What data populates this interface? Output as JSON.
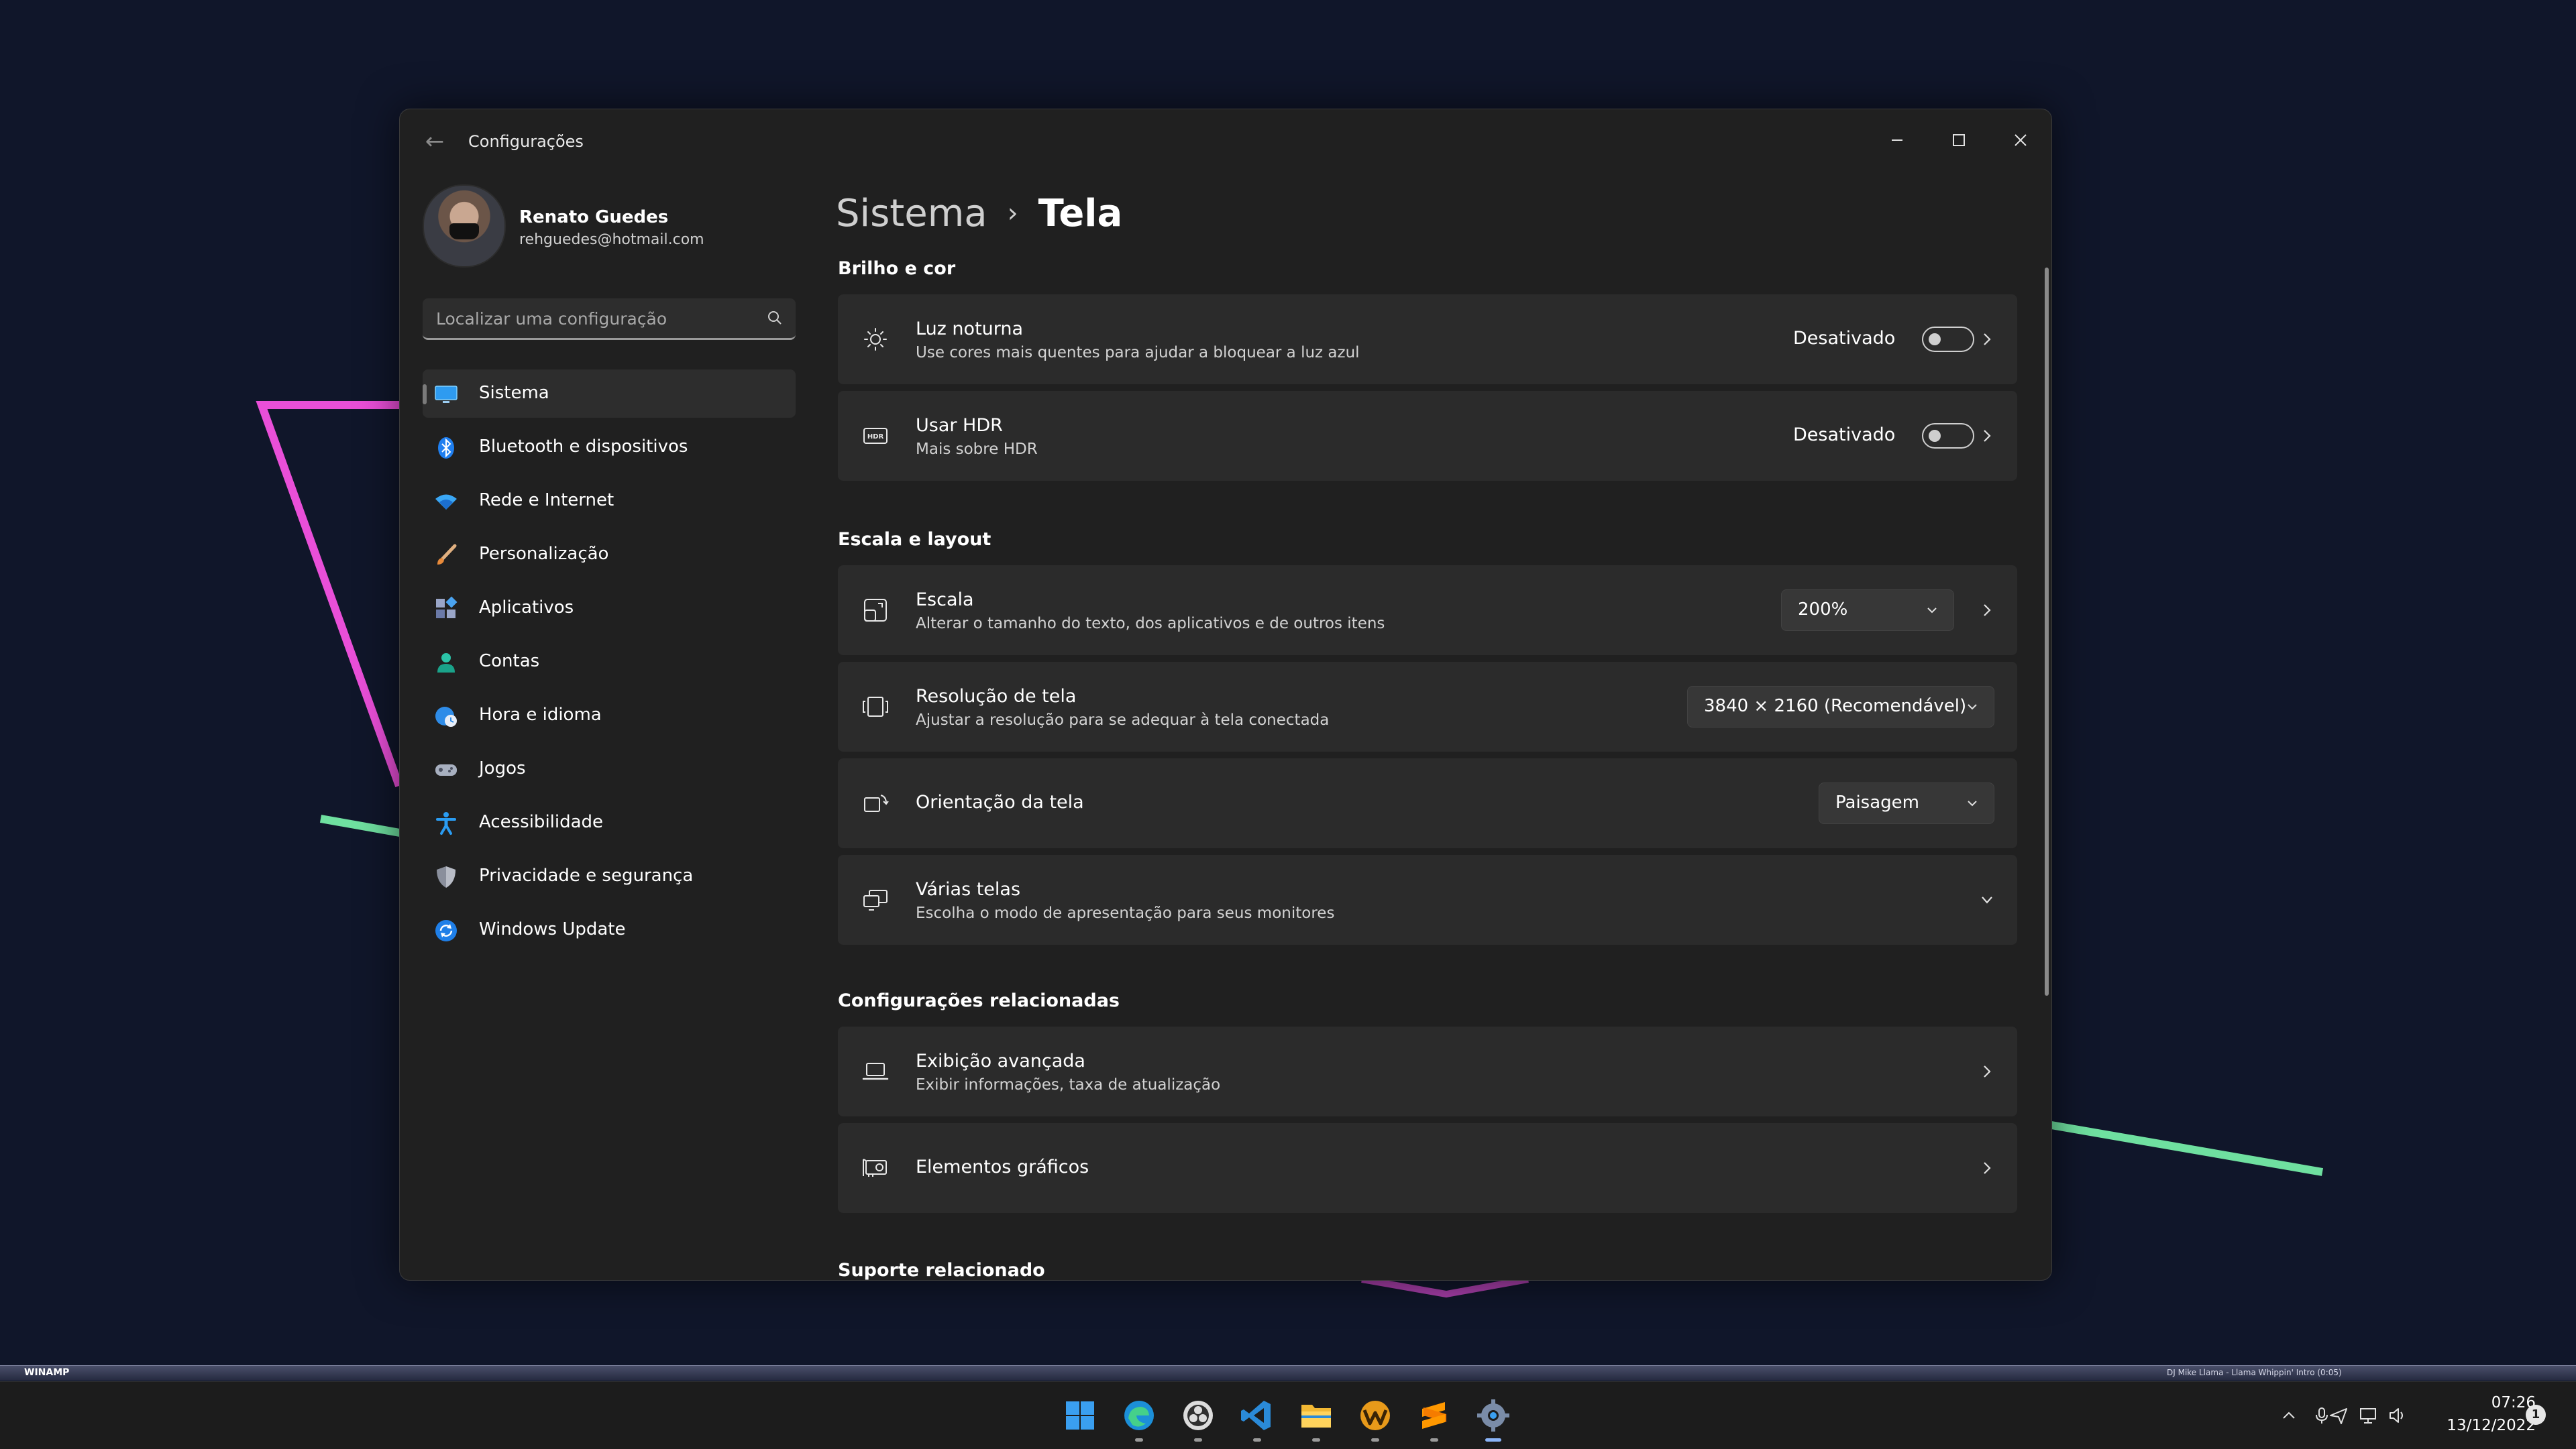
{
  "window": {
    "app_title": "Configurações",
    "controls": [
      "minimize-icon",
      "maximize-icon",
      "close-icon"
    ]
  },
  "profile": {
    "name": "Renato Guedes",
    "email": "rehguedes@hotmail.com"
  },
  "search": {
    "placeholder": "Localizar uma configuração",
    "value": ""
  },
  "sidebar": {
    "items": [
      {
        "label": "Sistema",
        "icon": "monitor-icon",
        "active": true
      },
      {
        "label": "Bluetooth e dispositivos",
        "icon": "bluetooth-icon",
        "active": false
      },
      {
        "label": "Rede e Internet",
        "icon": "wifi-icon",
        "active": false
      },
      {
        "label": "Personalização",
        "icon": "brush-icon",
        "active": false
      },
      {
        "label": "Aplicativos",
        "icon": "apps-icon",
        "active": false
      },
      {
        "label": "Contas",
        "icon": "person-icon",
        "active": false
      },
      {
        "label": "Hora e idioma",
        "icon": "globe-clock-icon",
        "active": false
      },
      {
        "label": "Jogos",
        "icon": "gamepad-icon",
        "active": false
      },
      {
        "label": "Acessibilidade",
        "icon": "accessibility-icon",
        "active": false
      },
      {
        "label": "Privacidade e segurança",
        "icon": "shield-icon",
        "active": false
      },
      {
        "label": "Windows Update",
        "icon": "update-icon",
        "active": false
      }
    ]
  },
  "breadcrumb": {
    "parent": "Sistema",
    "separator": "›",
    "current": "Tela"
  },
  "sections": {
    "brightness": "Brilho e cor",
    "scale_layout": "Escala e layout",
    "related_settings": "Configurações relacionadas",
    "related_support": "Suporte relacionado"
  },
  "settings": {
    "night_light": {
      "title": "Luz noturna",
      "subtitle": "Use cores mais quentes para ajudar a bloquear a luz azul",
      "state": "Desativado",
      "on": false
    },
    "hdr": {
      "title": "Usar HDR",
      "subtitle": "Mais sobre HDR",
      "state": "Desativado",
      "on": false
    },
    "scale": {
      "title": "Escala",
      "subtitle": "Alterar o tamanho do texto, dos aplicativos e de outros itens",
      "value": "200%"
    },
    "resolution": {
      "title": "Resolução de tela",
      "subtitle": "Ajustar a resolução para se adequar à tela conectada",
      "value": "3840 × 2160 (Recomendável)"
    },
    "orientation": {
      "title": "Orientação da tela",
      "value": "Paisagem"
    },
    "multiple_displays": {
      "title": "Várias telas",
      "subtitle": "Escolha o modo de apresentação para seus monitores"
    },
    "advanced_display": {
      "title": "Exibição avançada",
      "subtitle": "Exibir informações, taxa de atualização"
    },
    "graphics": {
      "title": "Elementos gráficos"
    }
  },
  "winamp": {
    "logo": "WINAMP",
    "track": "DJ Mike Llama - Llama Whippin' Intro (0:05)"
  },
  "taskbar": {
    "apps": [
      "start-icon",
      "edge-icon",
      "obs-icon",
      "vscode-icon",
      "file-explorer-icon",
      "winamp-icon",
      "sublime-icon",
      "settings-icon"
    ],
    "time": "07:26",
    "date": "13/12/2022",
    "notifications": "1"
  },
  "colors": {
    "wallpaper": "#10162a",
    "window_bg": "#202020",
    "card_bg": "#2b2b2b",
    "accent": "#8ab4f8",
    "pink_line": "#e94fd8",
    "green_line": "#6fe0a0"
  }
}
